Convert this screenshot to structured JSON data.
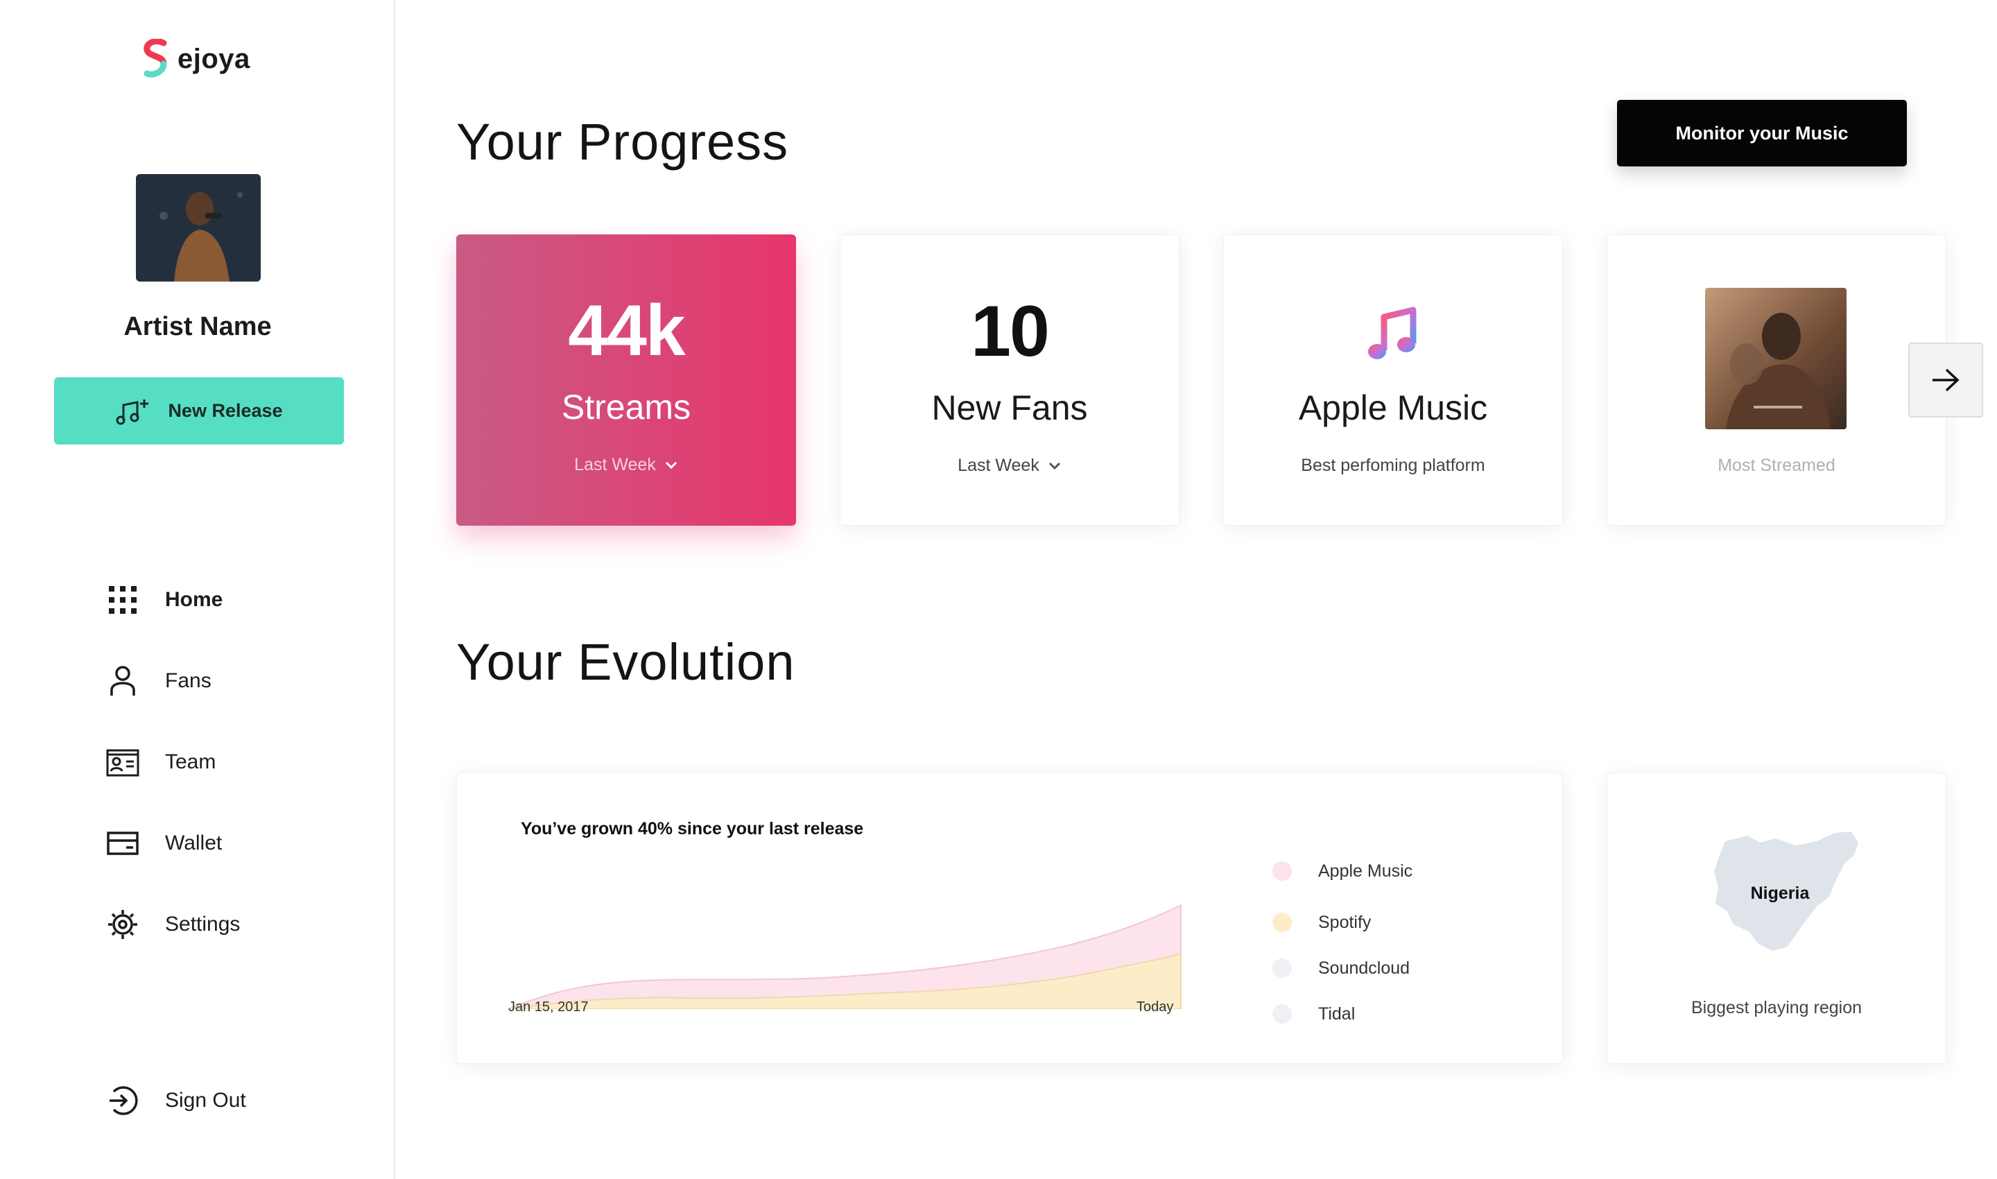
{
  "brand": {
    "name": "ejoya",
    "colors": [
      "#f0394f",
      "#5adcc6"
    ]
  },
  "sidebar": {
    "artist_name": "Artist Name",
    "new_release_label": "New Release",
    "nav": [
      {
        "label": "Home",
        "icon": "grid-icon",
        "active": true
      },
      {
        "label": "Fans",
        "icon": "user-icon"
      },
      {
        "label": "Team",
        "icon": "id-card-icon"
      },
      {
        "label": "Wallet",
        "icon": "wallet-icon"
      },
      {
        "label": "Settings",
        "icon": "gear-icon"
      }
    ],
    "sign_out_label": "Sign Out"
  },
  "header": {
    "title": "Your Progress",
    "monitor_label": "Monitor your Music"
  },
  "cards": {
    "streams": {
      "value": "44k",
      "label": "Streams",
      "period": "Last Week"
    },
    "fans": {
      "value": "10",
      "label": "New Fans",
      "period": "Last Week"
    },
    "platform": {
      "name": "Apple Music",
      "caption": "Best perfoming platform",
      "icon": "apple-music-icon"
    },
    "most_streamed": {
      "caption": "Most Streamed"
    }
  },
  "evolution": {
    "title": "Your Evolution",
    "headline": "You’ve grown 40% since your last release",
    "x_start": "Jan 15, 2017",
    "x_end": "Today",
    "legend": [
      {
        "name": "Apple Music",
        "color": "#fde3ec"
      },
      {
        "name": "Spotify",
        "color": "#fdecc8"
      },
      {
        "name": "Soundcloud",
        "color": "#eef0f4"
      },
      {
        "name": "Tidal",
        "color": "#eef0f4"
      }
    ]
  },
  "region": {
    "name": "Nigeria",
    "caption": "Biggest playing region"
  },
  "accent": {
    "teal": "#55dec3",
    "pink": "#e7366b",
    "black": "#050505"
  }
}
